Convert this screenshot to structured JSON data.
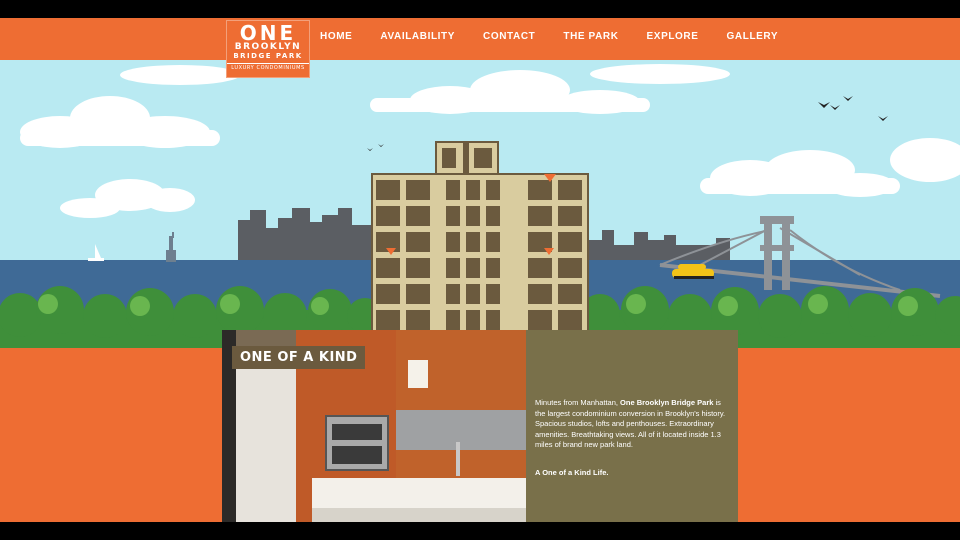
{
  "logo": {
    "line1": "ONE",
    "line2": "BROOKLYN",
    "line3": "BRIDGE PARK",
    "tagline": "LUXURY CONDOMINIUMS"
  },
  "nav": {
    "items": [
      {
        "label": "HOME"
      },
      {
        "label": "AVAILABILITY"
      },
      {
        "label": "CONTACT"
      },
      {
        "label": "THE PARK"
      },
      {
        "label": "EXPLORE"
      },
      {
        "label": "GALLERY"
      }
    ]
  },
  "content": {
    "title": "ONE OF A KIND",
    "intro_prefix": "Minutes from Manhattan, ",
    "intro_bold": "One Brooklyn Bridge Park",
    "intro_suffix": " is the largest condominium conversion in Brooklyn's history.  Spacious studios, lofts and penthouses. Extraordinary amenities. Breathtaking views. All of it located inside 1.3 miles of brand new park land.",
    "tagline": "A One of a Kind Life."
  },
  "colors": {
    "brand_orange": "#ee6d33",
    "sky": "#b9eaf2",
    "water": "#3f6a96",
    "skyline": "#5b5e63",
    "building": "#d9cc9f",
    "trees": "#3f8f3a"
  }
}
